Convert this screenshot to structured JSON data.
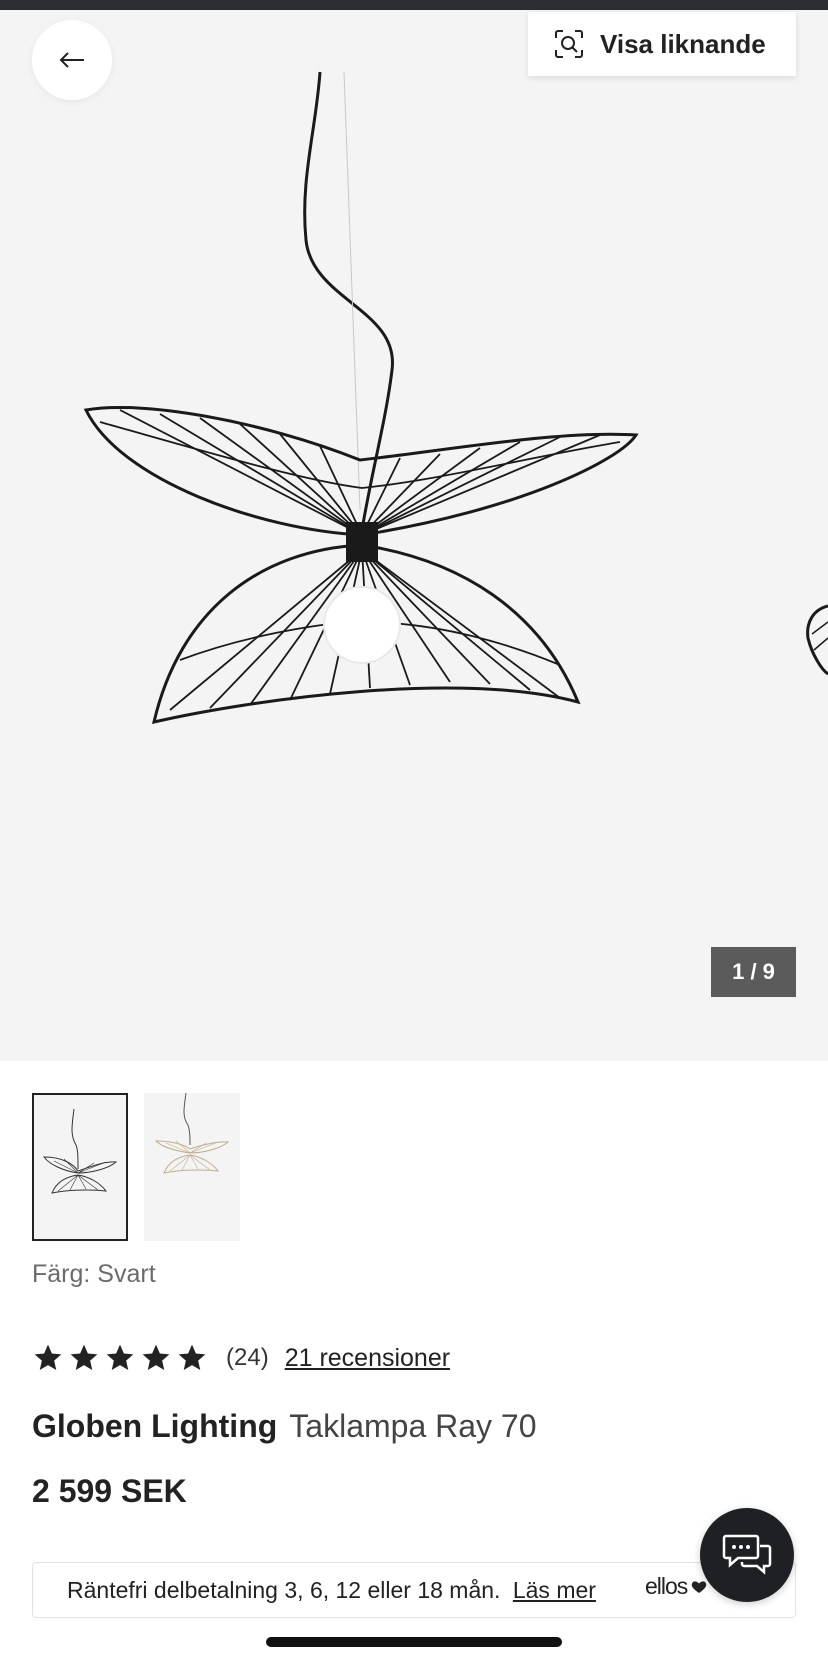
{
  "gallery": {
    "similar_label": "Visa liknande",
    "counter": "1 / 9"
  },
  "product": {
    "color_label": "Färg: Svart",
    "rating": 5,
    "rating_count": "(24)",
    "reviews_link": "21 recensioner",
    "brand": "Globen Lighting",
    "name": "Taklampa Ray 70",
    "price": "2 599 SEK"
  },
  "financing": {
    "text": "Räntefri delbetalning 3, 6, 12 eller 18 mån.",
    "read_more": "Läs mer",
    "logo_text": "ellos"
  },
  "icons": {
    "back": "arrow-left-icon",
    "similar": "visual-search-icon",
    "star": "star-icon",
    "chat": "chat-bubbles-icon",
    "heart": "heart-icon"
  }
}
